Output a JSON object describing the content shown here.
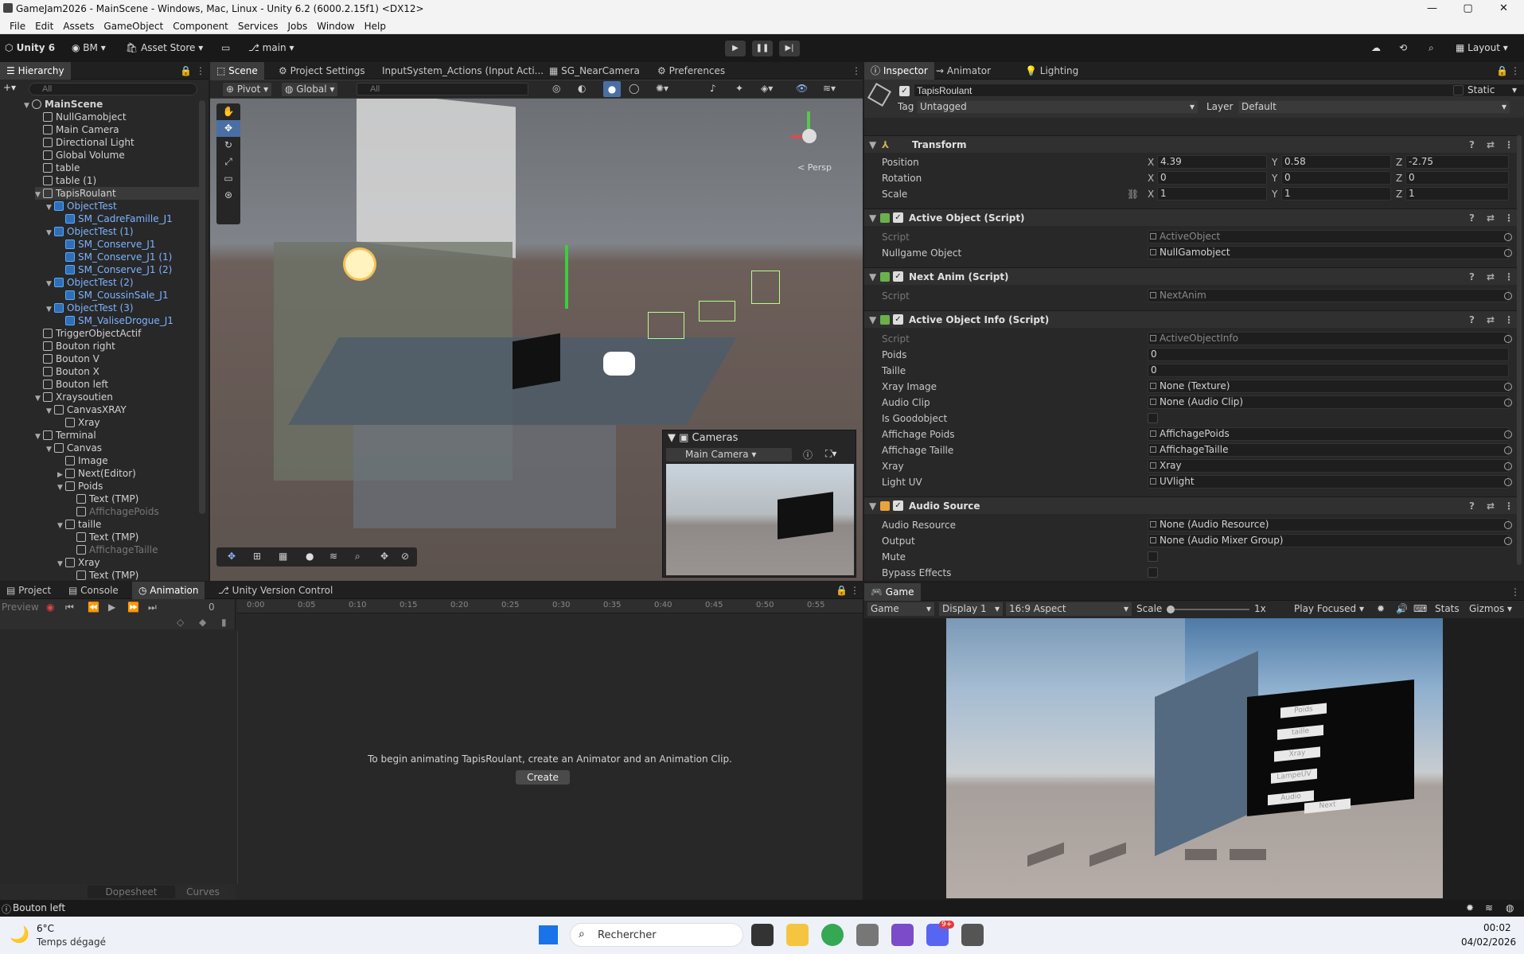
{
  "window": {
    "title": "GameJam2026 - MainScene - Windows, Mac, Linux - Unity 6.2 (6000.2.15f1) <DX12>",
    "minimize": "—",
    "maximize": "▢",
    "close": "✕"
  },
  "menu": [
    "File",
    "Edit",
    "Assets",
    "GameObject",
    "Component",
    "Services",
    "Jobs",
    "Window",
    "Help"
  ],
  "toolbar": {
    "unity_label": "Unity 6",
    "account": "BM",
    "asset_store": "Asset Store",
    "branch": "main",
    "layout": "Layout"
  },
  "hierarchy": {
    "tab": "Hierarchy",
    "search_placeholder": "All",
    "scene": "MainScene",
    "items": [
      {
        "label": "NullGamobject",
        "depth": 1,
        "arrow": "",
        "blue": false
      },
      {
        "label": "Main Camera",
        "depth": 1,
        "arrow": "",
        "blue": false
      },
      {
        "label": "Directional Light",
        "depth": 1,
        "arrow": "",
        "blue": false
      },
      {
        "label": "Global Volume",
        "depth": 1,
        "arrow": "",
        "blue": false
      },
      {
        "label": "table",
        "depth": 1,
        "arrow": "",
        "blue": false
      },
      {
        "label": "table (1)",
        "depth": 1,
        "arrow": "",
        "blue": false
      },
      {
        "label": "TapisRoulant",
        "depth": 1,
        "arrow": "▼",
        "blue": false,
        "selected": true
      },
      {
        "label": "ObjectTest",
        "depth": 2,
        "arrow": "▼",
        "blue": true
      },
      {
        "label": "SM_CadreFamille_J1",
        "depth": 3,
        "arrow": "",
        "blue": true
      },
      {
        "label": "ObjectTest (1)",
        "depth": 2,
        "arrow": "▼",
        "blue": true
      },
      {
        "label": "SM_Conserve_J1",
        "depth": 3,
        "arrow": "",
        "blue": true
      },
      {
        "label": "SM_Conserve_J1 (1)",
        "depth": 3,
        "arrow": "",
        "blue": true
      },
      {
        "label": "SM_Conserve_J1 (2)",
        "depth": 3,
        "arrow": "",
        "blue": true
      },
      {
        "label": "ObjectTest (2)",
        "depth": 2,
        "arrow": "▼",
        "blue": true
      },
      {
        "label": "SM_CoussinSale_J1",
        "depth": 3,
        "arrow": "",
        "blue": true
      },
      {
        "label": "ObjectTest (3)",
        "depth": 2,
        "arrow": "▼",
        "blue": true
      },
      {
        "label": "SM_ValiseDrogue_J1",
        "depth": 3,
        "arrow": "",
        "blue": true
      },
      {
        "label": "TriggerObjectActif",
        "depth": 1,
        "arrow": "",
        "blue": false
      },
      {
        "label": "Bouton right",
        "depth": 1,
        "arrow": "",
        "blue": false
      },
      {
        "label": "Bouton V",
        "depth": 1,
        "arrow": "",
        "blue": false
      },
      {
        "label": "Bouton X",
        "depth": 1,
        "arrow": "",
        "blue": false
      },
      {
        "label": "Bouton left",
        "depth": 1,
        "arrow": "",
        "blue": false
      },
      {
        "label": "Xraysoutien",
        "depth": 1,
        "arrow": "▼",
        "blue": false
      },
      {
        "label": "CanvasXRAY",
        "depth": 2,
        "arrow": "▼",
        "blue": false
      },
      {
        "label": "Xray",
        "depth": 3,
        "arrow": "",
        "blue": false
      },
      {
        "label": "Terminal",
        "depth": 1,
        "arrow": "▼",
        "blue": false
      },
      {
        "label": "Canvas",
        "depth": 2,
        "arrow": "▼",
        "blue": false
      },
      {
        "label": "Image",
        "depth": 3,
        "arrow": "",
        "blue": false
      },
      {
        "label": "Next(Editor)",
        "depth": 3,
        "arrow": "▶",
        "blue": false
      },
      {
        "label": "Poids",
        "depth": 3,
        "arrow": "▼",
        "blue": false
      },
      {
        "label": "Text (TMP)",
        "depth": 4,
        "arrow": "",
        "blue": false
      },
      {
        "label": "AffichagePoids",
        "depth": 4,
        "arrow": "",
        "blue": false,
        "dim": true
      },
      {
        "label": "taille",
        "depth": 3,
        "arrow": "▼",
        "blue": false
      },
      {
        "label": "Text (TMP)",
        "depth": 4,
        "arrow": "",
        "blue": false
      },
      {
        "label": "AffichageTaille",
        "depth": 4,
        "arrow": "",
        "blue": false,
        "dim": true
      },
      {
        "label": "Xray",
        "depth": 3,
        "arrow": "▼",
        "blue": false
      },
      {
        "label": "Text (TMP)",
        "depth": 4,
        "arrow": "",
        "blue": false
      }
    ]
  },
  "scene_tabs": [
    "Scene",
    "Project Settings",
    "InputSystem_Actions (Input Acti...",
    "SG_NearCamera",
    "Preferences"
  ],
  "scene_toolbar": {
    "pivot": "Pivot",
    "global": "Global",
    "search_placeholder": "All",
    "persp": "< Persp"
  },
  "cameras_overlay": {
    "title": "Cameras",
    "selected": "Main Camera"
  },
  "inspector": {
    "tabs": [
      "Inspector",
      "Animator",
      "Lighting"
    ],
    "object_name": "TapisRoulant",
    "static_label": "Static",
    "tag_label": "Tag",
    "tag_value": "Untagged",
    "layer_label": "Layer",
    "layer_value": "Default",
    "transform": {
      "title": "Transform",
      "position_label": "Position",
      "rotation_label": "Rotation",
      "scale_label": "Scale",
      "position": [
        "4.39",
        "0.58",
        "-2.75"
      ],
      "rotation": [
        "0",
        "0",
        "0"
      ],
      "scale": [
        "1",
        "1",
        "1"
      ]
    },
    "active_object": {
      "title": "Active Object (Script)",
      "script_label": "Script",
      "script_value": "ActiveObject",
      "null_label": "Nullgame Object",
      "null_value": "NullGamobject"
    },
    "next_anim": {
      "title": "Next Anim (Script)",
      "script_label": "Script",
      "script_value": "NextAnim"
    },
    "active_info": {
      "title": "Active Object Info (Script)",
      "rows": [
        {
          "label": "Script",
          "value": "ActiveObjectInfo",
          "dim": true
        },
        {
          "label": "Poids",
          "value": "0"
        },
        {
          "label": "Taille",
          "value": "0"
        },
        {
          "label": "Xray Image",
          "value": "None (Texture)"
        },
        {
          "label": "Audio Clip",
          "value": "None (Audio Clip)"
        },
        {
          "label": "Is Goodobject",
          "value": ""
        },
        {
          "label": "Affichage Poids",
          "value": "AffichagePoids"
        },
        {
          "label": "Affichage Taille",
          "value": "AffichageTaille"
        },
        {
          "label": "Xray",
          "value": "Xray"
        },
        {
          "label": "Light UV",
          "value": "UVlight"
        }
      ]
    },
    "audio_source": {
      "title": "Audio Source",
      "rows": [
        {
          "label": "Audio Resource",
          "value": "None (Audio Resource)"
        },
        {
          "label": "Output",
          "value": "None (Audio Mixer Group)"
        },
        {
          "label": "Mute",
          "value": ""
        },
        {
          "label": "Bypass Effects",
          "value": ""
        }
      ]
    }
  },
  "bottom_tabs": [
    "Project",
    "Console",
    "Animation",
    "Unity Version Control"
  ],
  "animation": {
    "preview": "Preview",
    "frame": "0",
    "ticks": [
      "0:00",
      "0:05",
      "0:10",
      "0:15",
      "0:20",
      "0:25",
      "0:30",
      "0:35",
      "0:40",
      "0:45",
      "0:50",
      "0:55"
    ],
    "message": "To begin animating TapisRoulant, create an Animator and an Animation Clip.",
    "create": "Create",
    "dopesheet": "Dopesheet",
    "curves": "Curves"
  },
  "game": {
    "tab": "Game",
    "mode": "Game",
    "display": "Display 1",
    "aspect": "16:9 Aspect",
    "scale_label": "Scale",
    "scale_value": "1x",
    "play_focused": "Play Focused",
    "stats": "Stats",
    "gizmos": "Gizmos",
    "buttons": [
      "Poids",
      "taille",
      "Xray",
      "LampeUV",
      "Audio",
      "Next"
    ]
  },
  "status": {
    "message": "Bouton left"
  },
  "taskbar": {
    "weather_temp": "6°C",
    "weather_desc": "Temps dégagé",
    "search": "Rechercher",
    "time": "00:02",
    "date": "04/02/2026",
    "discord_badge": "9+"
  }
}
